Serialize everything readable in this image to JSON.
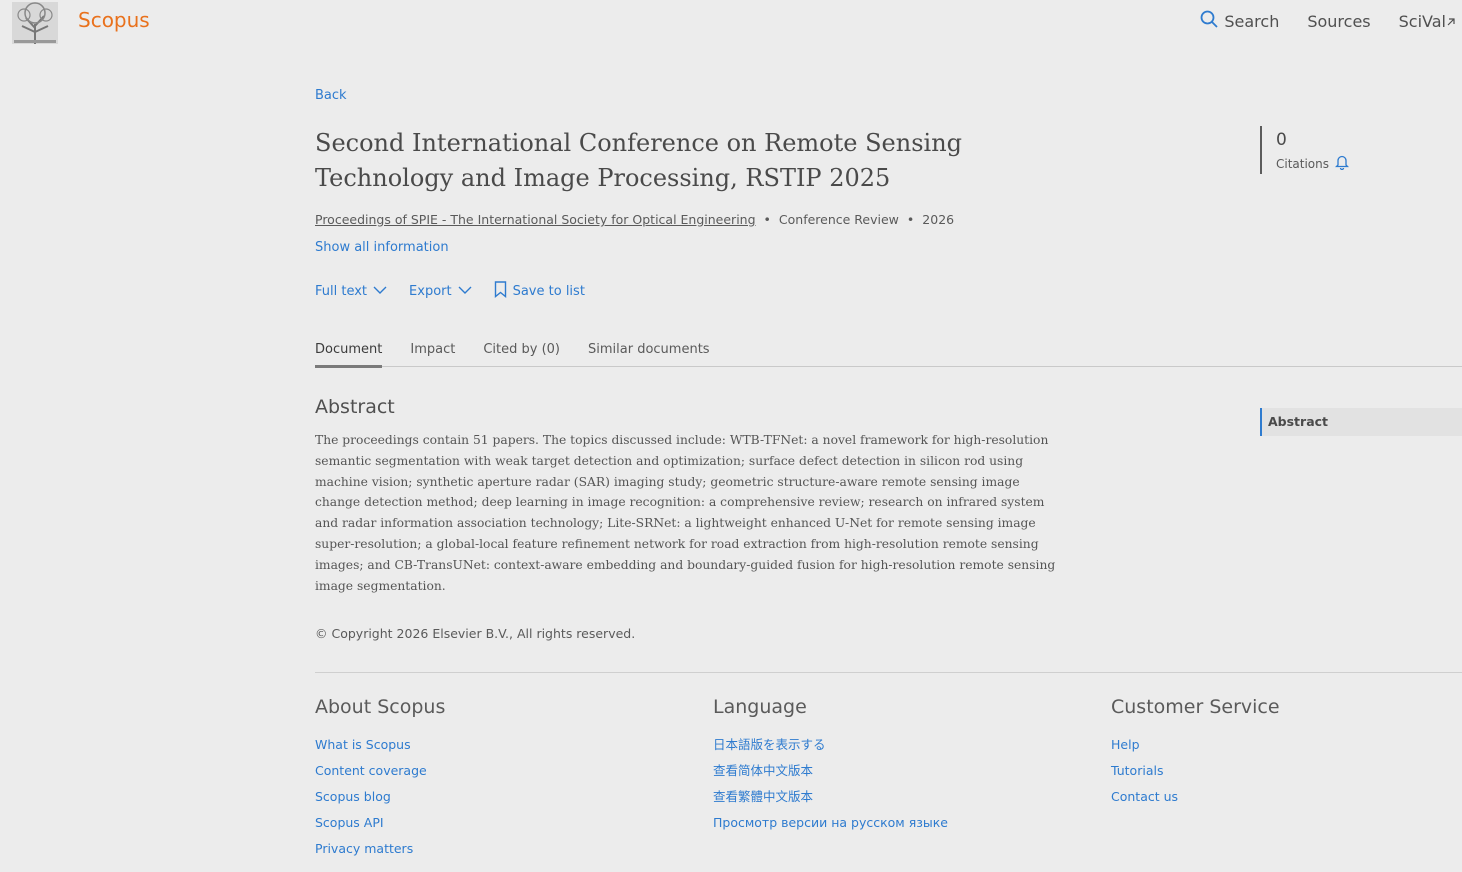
{
  "header": {
    "brand": "Scopus",
    "nav": {
      "search": "Search",
      "sources": "Sources",
      "scival": "SciVal"
    }
  },
  "page": {
    "back": "Back",
    "title": "Second International Conference on Remote Sensing Technology and Image Processing, RSTIP 2025",
    "meta": {
      "source": "Proceedings of SPIE - The International Society for Optical Engineering",
      "doc_type": "Conference Review",
      "year": "2026"
    },
    "show_all": "Show all information",
    "actions": {
      "full_text": "Full text",
      "export": "Export",
      "save": "Save to list"
    },
    "tabs": [
      "Document",
      "Impact",
      "Cited by (0)",
      "Similar documents"
    ],
    "abstract_heading": "Abstract",
    "abstract": "The proceedings contain 51 papers. The topics discussed include: WTB-TFNet: a novel framework for high-resolution semantic segmentation with weak target detection and optimization; surface defect detection in silicon rod using machine vision; synthetic aperture radar (SAR) imaging study; geometric structure-aware remote sensing image change detection method; deep learning in image recognition: a comprehensive review; research on infrared system and radar information association technology; Lite-SRNet: a lightweight enhanced U-Net for remote sensing image super-resolution; a global-local feature refinement network for road extraction from high-resolution remote sensing images; and CB-TransUNet: context-aware embedding and boundary-guided fusion for high-resolution remote sensing image segmentation.",
    "copyright": "Copyright 2026 Elsevier B.V., All rights reserved."
  },
  "citations": {
    "count": "0",
    "label": "Citations"
  },
  "sidenav": {
    "item": "Abstract"
  },
  "footer": {
    "about": {
      "heading": "About Scopus",
      "links": [
        "What is Scopus",
        "Content coverage",
        "Scopus blog",
        "Scopus API",
        "Privacy matters"
      ]
    },
    "language": {
      "heading": "Language",
      "links": [
        "日本語版を表示する",
        "查看简体中文版本",
        "查看繁體中文版本",
        "Просмотр версии на русском языке"
      ]
    },
    "service": {
      "heading": "Customer Service",
      "links": [
        "Help",
        "Tutorials",
        "Contact us"
      ]
    }
  },
  "colors": {
    "accent": "#2e7bcf",
    "brand": "#e9711c",
    "background": "#ececec"
  }
}
